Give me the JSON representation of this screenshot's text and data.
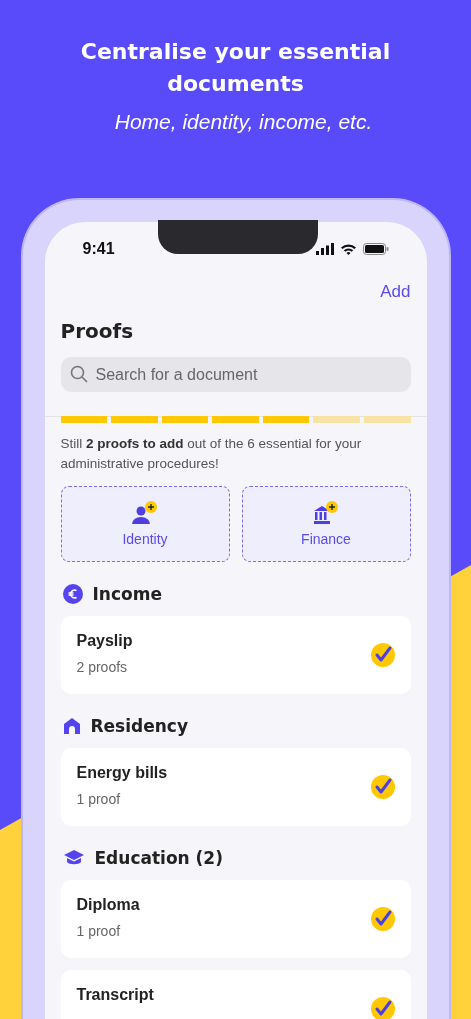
{
  "headline": "Centralise your essential documents",
  "subheadline": "Home, identity, income, etc.",
  "status_bar": {
    "time": "9:41"
  },
  "nav": {
    "action": "Add"
  },
  "title": "Proofs",
  "search": {
    "placeholder": "Search for a document"
  },
  "progress": {
    "segments": [
      {
        "filled": true
      },
      {
        "filled": true
      },
      {
        "filled": true
      },
      {
        "filled": true
      },
      {
        "filled": true
      },
      {
        "filled": false
      },
      {
        "filled": false
      }
    ]
  },
  "message": "Still **2 proofs to add** out of the 6 essential for your administrative procedures!",
  "missing": [
    {
      "kind": "identity",
      "label": "Identity"
    },
    {
      "kind": "finance",
      "label": "Finance"
    }
  ],
  "categories": [
    {
      "kind": "income",
      "title": "Income",
      "items": [
        {
          "title": "Payslip",
          "subtitle": "2 proofs",
          "checked": true
        }
      ]
    },
    {
      "kind": "residency",
      "title": "Residency",
      "items": [
        {
          "title": "Energy bills",
          "subtitle": "1 proof",
          "checked": true
        }
      ]
    },
    {
      "kind": "education",
      "title": "Education (2)",
      "items": [
        {
          "title": "Diploma",
          "subtitle": "1 proof",
          "checked": true
        },
        {
          "title": "Transcript",
          "checked": true
        }
      ]
    }
  ]
}
